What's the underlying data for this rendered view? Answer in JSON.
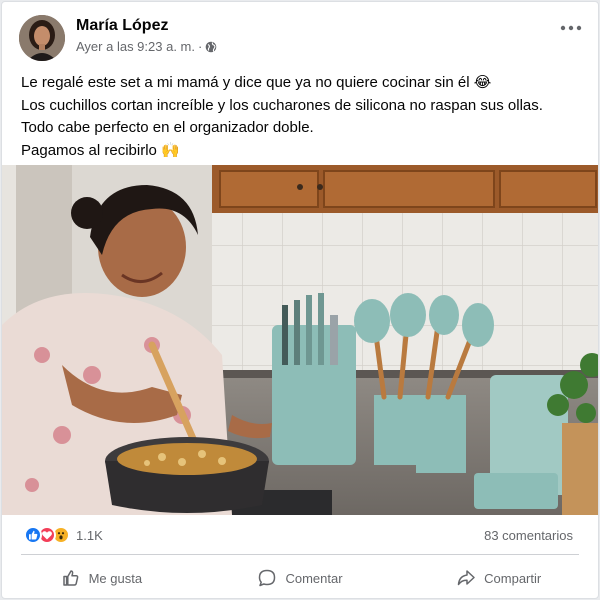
{
  "post": {
    "author": "María López",
    "timestamp": "Ayer a las 9:23 a. m.",
    "separator": "·",
    "privacy_icon": "globe-icon",
    "more_icon": "more-options-icon",
    "lines": [
      "Le regalé este set a mi mamá y dice que ya no quiere cocinar sin él 😂",
      "Los cuchillos cortan increíble y los cucharones de silicona no raspan sus ollas.",
      "Todo cabe perfecto en el organizador doble.",
      "Pagamos al recibirlo 🙌"
    ]
  },
  "counts": {
    "reactions": "1.1K",
    "reaction_icons": [
      "like-icon",
      "love-icon",
      "wow-icon"
    ],
    "comments": "83 comentarios"
  },
  "actions": {
    "like": "Me gusta",
    "comment": "Comentar",
    "share": "Compartir"
  },
  "colors": {
    "link_blue": "#1877f2",
    "love_red": "#f33e58",
    "wow_yellow": "#f7b125",
    "secondary_text": "#65676b",
    "utensil_mint": "#8dbdb7"
  }
}
